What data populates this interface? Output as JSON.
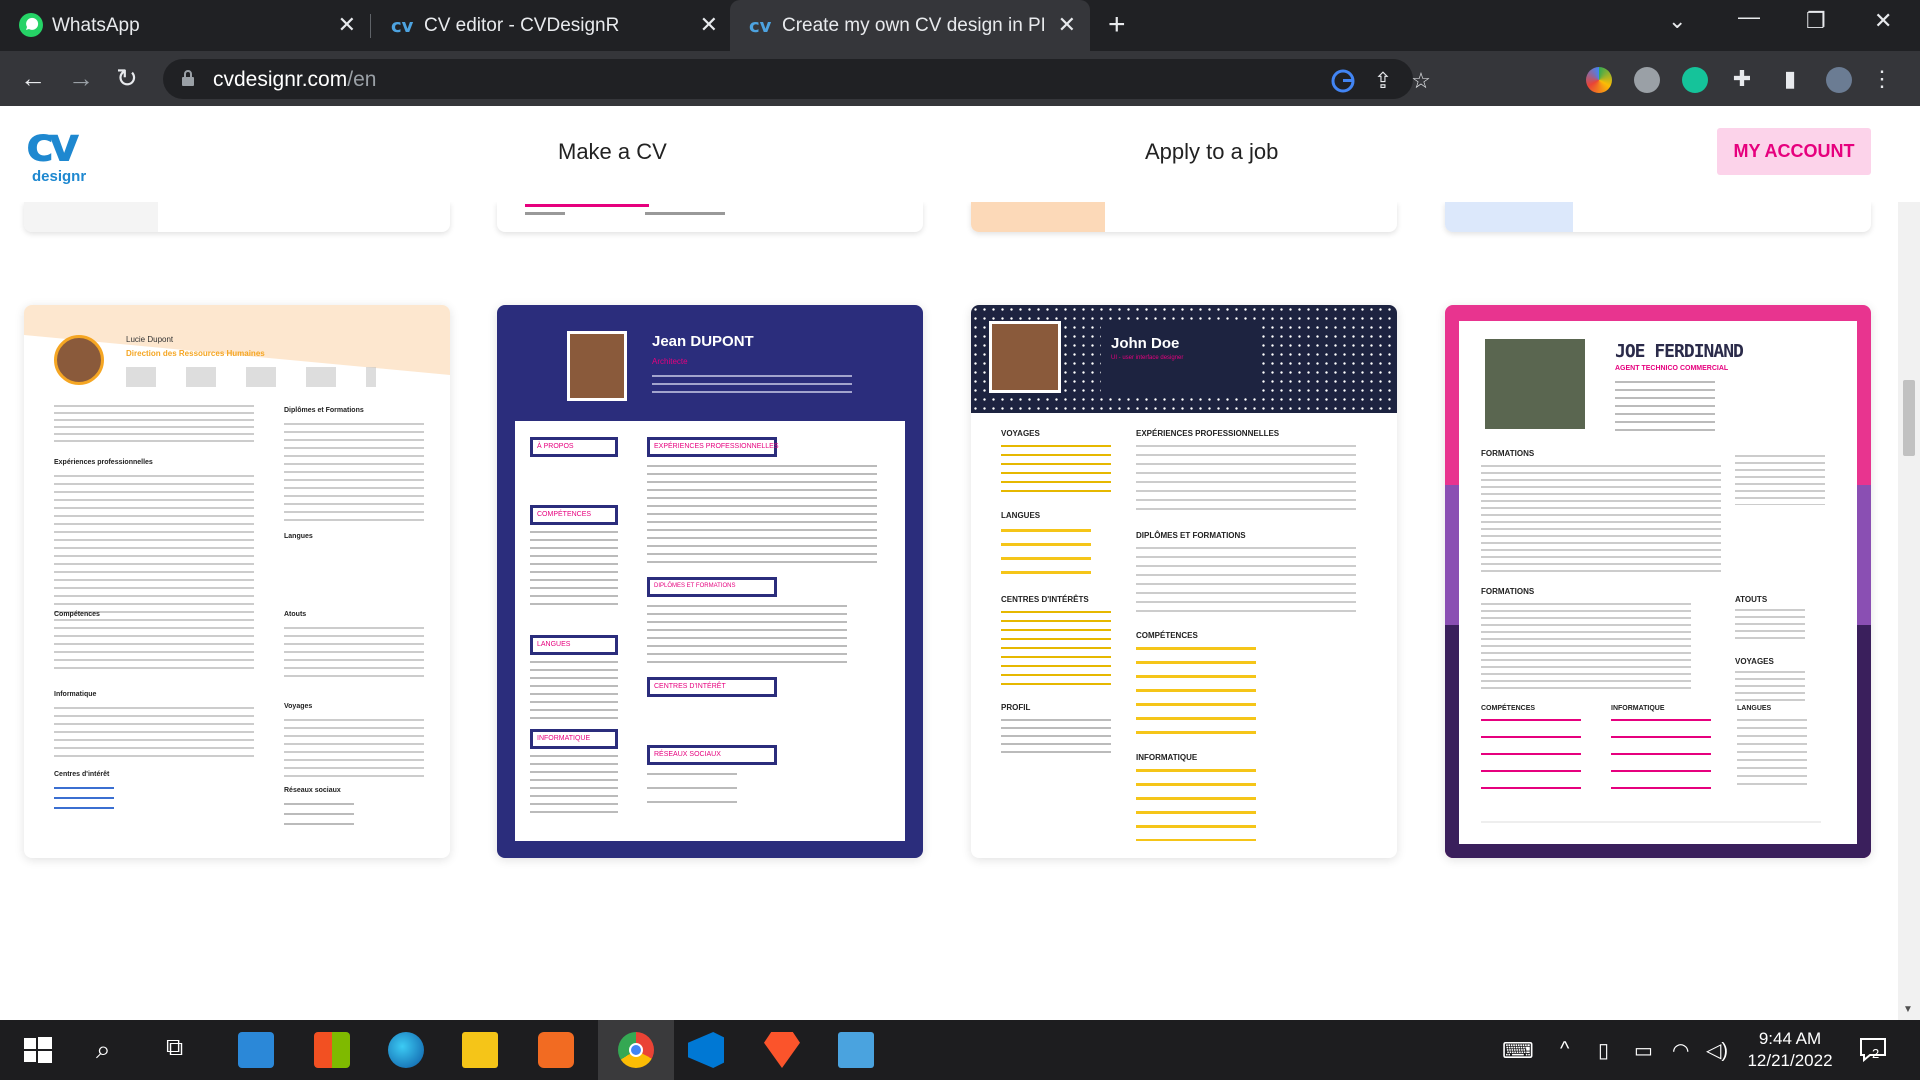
{
  "browser": {
    "tabs": [
      {
        "title": "WhatsApp",
        "icon": "whatsapp-icon",
        "active": false
      },
      {
        "title": "CV editor - CVDesignR",
        "icon": "cvdesignr-icon",
        "active": false
      },
      {
        "title": "Create my own CV design in PDF",
        "icon": "cvdesignr-icon",
        "active": true
      }
    ],
    "url_host": "cvdesignr.com",
    "url_path": "/en"
  },
  "site": {
    "logo_mark": "cv",
    "logo_text": "designr",
    "nav": {
      "make_cv": "Make a CV",
      "apply_job": "Apply to a job"
    },
    "account_button": "MY ACCOUNT"
  },
  "templates": [
    {
      "name": "Lucie Dupont",
      "title": "Direction des Ressources Humaines",
      "sections": [
        "Expériences professionnelles",
        "Diplômes et Formations",
        "Langues",
        "Compétences",
        "Atouts",
        "Informatique",
        "Voyages",
        "Centres d'intérêt",
        "Réseaux sociaux"
      ],
      "accent": "#f5a623"
    },
    {
      "name": "Jean DUPONT",
      "title": "Architecte",
      "sections": [
        "À PROPOS",
        "EXPÉRIENCES PROFESSIONNELLES",
        "COMPÉTENCES",
        "DIPLÔMES ET FORMATIONS",
        "LANGUES",
        "CENTRES D'INTÉRÊT",
        "INFORMATIQUE",
        "RÉSEAUX SOCIAUX"
      ],
      "accent": "#e6007e"
    },
    {
      "name": "John Doe",
      "title": "UI - user interface designer",
      "sections": [
        "VOYAGES",
        "EXPÉRIENCES PROFESSIONNELLES",
        "LANGUES",
        "DIPLÔMES ET FORMATIONS",
        "CENTRES D'INTÉRÊTS",
        "COMPÉTENCES",
        "PROFIL",
        "INFORMATIQUE"
      ],
      "accent": "#f5c518"
    },
    {
      "name": "JOE FERDINAND",
      "title": "AGENT TECHNICO COMMERCIAL",
      "sections": [
        "FORMATIONS",
        "FORMATIONS",
        "ATOUTS",
        "VOYAGES",
        "COMPÉTENCES",
        "INFORMATIQUE",
        "LANGUES"
      ],
      "accent": "#e6007e"
    }
  ],
  "taskbar": {
    "time": "9:44 AM",
    "date": "12/21/2022",
    "notifications": "2"
  },
  "colors": {
    "brand": "#1e88d0",
    "account_bg": "#fcd3ea",
    "account_fg": "#e6007e",
    "navy": "#2b2d7c"
  }
}
